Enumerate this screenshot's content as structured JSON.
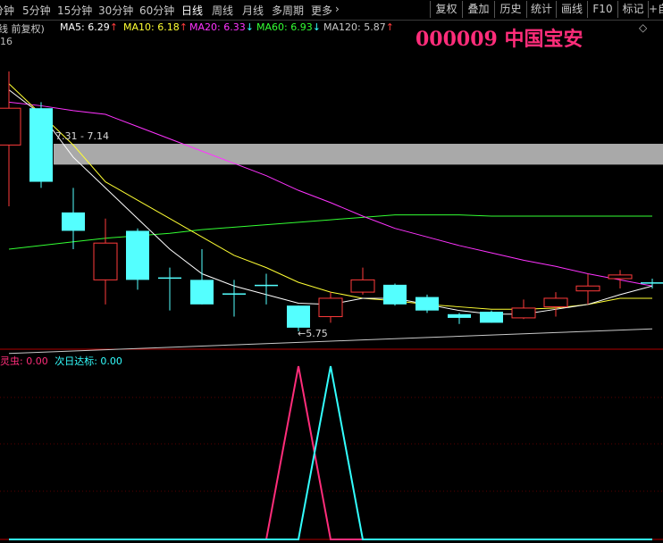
{
  "toolbar": {
    "tabs": [
      {
        "label": "分钟"
      },
      {
        "label": "5分钟"
      },
      {
        "label": "15分钟"
      },
      {
        "label": "30分钟"
      },
      {
        "label": "60分钟"
      },
      {
        "label": "日线"
      },
      {
        "label": "周线"
      },
      {
        "label": "月线"
      },
      {
        "label": "多周期"
      },
      {
        "label": "更多"
      }
    ],
    "active_tab": "日线",
    "more_arrow": "›",
    "buttons": [
      {
        "label": "复权"
      },
      {
        "label": "叠加"
      },
      {
        "label": "历史"
      },
      {
        "label": "统计"
      },
      {
        "label": "画线"
      },
      {
        "label": "F10"
      },
      {
        "label": "标记"
      },
      {
        "label": "+自"
      }
    ]
  },
  "ma_bar": {
    "prefix": "线 前复权)",
    "items": [
      {
        "label": "MA5: 6.29",
        "arrow": "↑",
        "color": "#ffffff",
        "arrow_color": "#ff3b3b"
      },
      {
        "label": "MA10: 6.18",
        "arrow": "↑",
        "color": "#ffff33",
        "arrow_color": "#ff3b3b"
      },
      {
        "label": "MA20: 6.33",
        "arrow": "↓",
        "color": "#ff33ff",
        "arrow_color": "#33ffff"
      },
      {
        "label": "MA60: 6.93",
        "arrow": "↓",
        "color": "#33ff33",
        "arrow_color": "#33ffff"
      },
      {
        "label": "MA120: 5.87",
        "arrow": "↑",
        "color": "#c8c8c8",
        "arrow_color": "#ff3b3b"
      }
    ]
  },
  "stock_title": "000009 中国宝安",
  "gear_icon_label": "◇",
  "left_number": "16",
  "price_chart": {
    "zone_label": "7.31 - 7.14",
    "low_label": "5.75",
    "candles": [
      {
        "o": 7.6,
        "c": 7.3,
        "h": 7.9,
        "l": 6.8,
        "up": true
      },
      {
        "o": 7.6,
        "c": 7.0,
        "h": 7.65,
        "l": 6.95,
        "up": false
      },
      {
        "o": 6.75,
        "c": 6.6,
        "h": 6.95,
        "l": 6.45,
        "up": false
      },
      {
        "o": 6.2,
        "c": 6.5,
        "h": 6.7,
        "l": 6.0,
        "up": true
      },
      {
        "o": 6.6,
        "c": 6.2,
        "h": 6.62,
        "l": 6.12,
        "up": false
      },
      {
        "o": 6.22,
        "c": 6.21,
        "h": 6.3,
        "l": 5.95,
        "up": false
      },
      {
        "o": 6.2,
        "c": 6.0,
        "h": 6.45,
        "l": 6.0,
        "up": false
      },
      {
        "o": 6.09,
        "c": 6.08,
        "h": 6.2,
        "l": 5.9,
        "up": false
      },
      {
        "o": 6.16,
        "c": 6.15,
        "h": 6.25,
        "l": 6.0,
        "up": false
      },
      {
        "o": 5.99,
        "c": 5.81,
        "h": 5.99,
        "l": 5.78,
        "up": false
      },
      {
        "o": 5.9,
        "c": 6.05,
        "h": 6.1,
        "l": 5.85,
        "up": true
      },
      {
        "o": 6.1,
        "c": 6.2,
        "h": 6.3,
        "l": 6.08,
        "up": true
      },
      {
        "o": 6.16,
        "c": 6.0,
        "h": 6.17,
        "l": 5.99,
        "up": false
      },
      {
        "o": 6.06,
        "c": 5.95,
        "h": 6.08,
        "l": 5.93,
        "up": false
      },
      {
        "o": 5.92,
        "c": 5.89,
        "h": 5.93,
        "l": 5.84,
        "up": false
      },
      {
        "o": 5.94,
        "c": 5.85,
        "h": 5.95,
        "l": 5.85,
        "up": false
      },
      {
        "o": 5.89,
        "c": 5.97,
        "h": 6.04,
        "l": 5.88,
        "up": true
      },
      {
        "o": 5.98,
        "c": 6.05,
        "h": 6.1,
        "l": 5.9,
        "up": true
      },
      {
        "o": 6.11,
        "c": 6.15,
        "h": 6.25,
        "l": 6.0,
        "up": true
      },
      {
        "o": 6.21,
        "c": 6.24,
        "h": 6.28,
        "l": 6.13,
        "up": true
      },
      {
        "o": 6.18,
        "c": 6.17,
        "h": 6.21,
        "l": 6.13,
        "up": false
      }
    ],
    "ma5": [
      7.75,
      7.55,
      7.2,
      6.95,
      6.7,
      6.45,
      6.25,
      6.15,
      6.08,
      6.01,
      6.0,
      6.05,
      6.05,
      6.0,
      5.95,
      5.92,
      5.92,
      5.96,
      6.0,
      6.08,
      6.15
    ],
    "ma10": [
      7.8,
      7.55,
      7.3,
      7.0,
      6.85,
      6.7,
      6.55,
      6.4,
      6.3,
      6.18,
      6.1,
      6.05,
      6.03,
      6.0,
      5.98,
      5.96,
      5.96,
      5.97,
      6.0,
      6.05,
      6.05
    ],
    "ma20": [
      7.65,
      7.62,
      7.58,
      7.55,
      7.45,
      7.35,
      7.25,
      7.15,
      7.05,
      6.93,
      6.83,
      6.72,
      6.62,
      6.55,
      6.48,
      6.42,
      6.36,
      6.31,
      6.25,
      6.2,
      6.15
    ],
    "ma60": [
      6.45,
      6.48,
      6.51,
      6.54,
      6.56,
      6.58,
      6.61,
      6.63,
      6.65,
      6.67,
      6.69,
      6.71,
      6.73,
      6.73,
      6.73,
      6.72,
      6.72,
      6.72,
      6.72,
      6.72,
      6.72
    ],
    "ma120": [
      5.6,
      5.61,
      5.62,
      5.63,
      5.64,
      5.65,
      5.66,
      5.67,
      5.68,
      5.69,
      5.7,
      5.71,
      5.72,
      5.73,
      5.74,
      5.75,
      5.76,
      5.77,
      5.78,
      5.79,
      5.8
    ]
  },
  "indicator": {
    "label_a": "灵虫: 0.00",
    "label_b": "次日达标: 0.00",
    "color_a": "#ff2d7a",
    "color_b": "#33ffff",
    "series_a": [
      0,
      0,
      0,
      0,
      0,
      0,
      0,
      0,
      0,
      1,
      0,
      0,
      0,
      0,
      0,
      0,
      0,
      0,
      0,
      0,
      0
    ],
    "series_b": [
      0,
      0,
      0,
      0,
      0,
      0,
      0,
      0,
      0,
      0,
      1,
      0,
      0,
      0,
      0,
      0,
      0,
      0,
      0,
      0,
      0
    ]
  },
  "colors": {
    "up": "#ff3b3b",
    "down": "#54ffff",
    "zone": "#a9a9a9",
    "axis": "#b00000"
  }
}
